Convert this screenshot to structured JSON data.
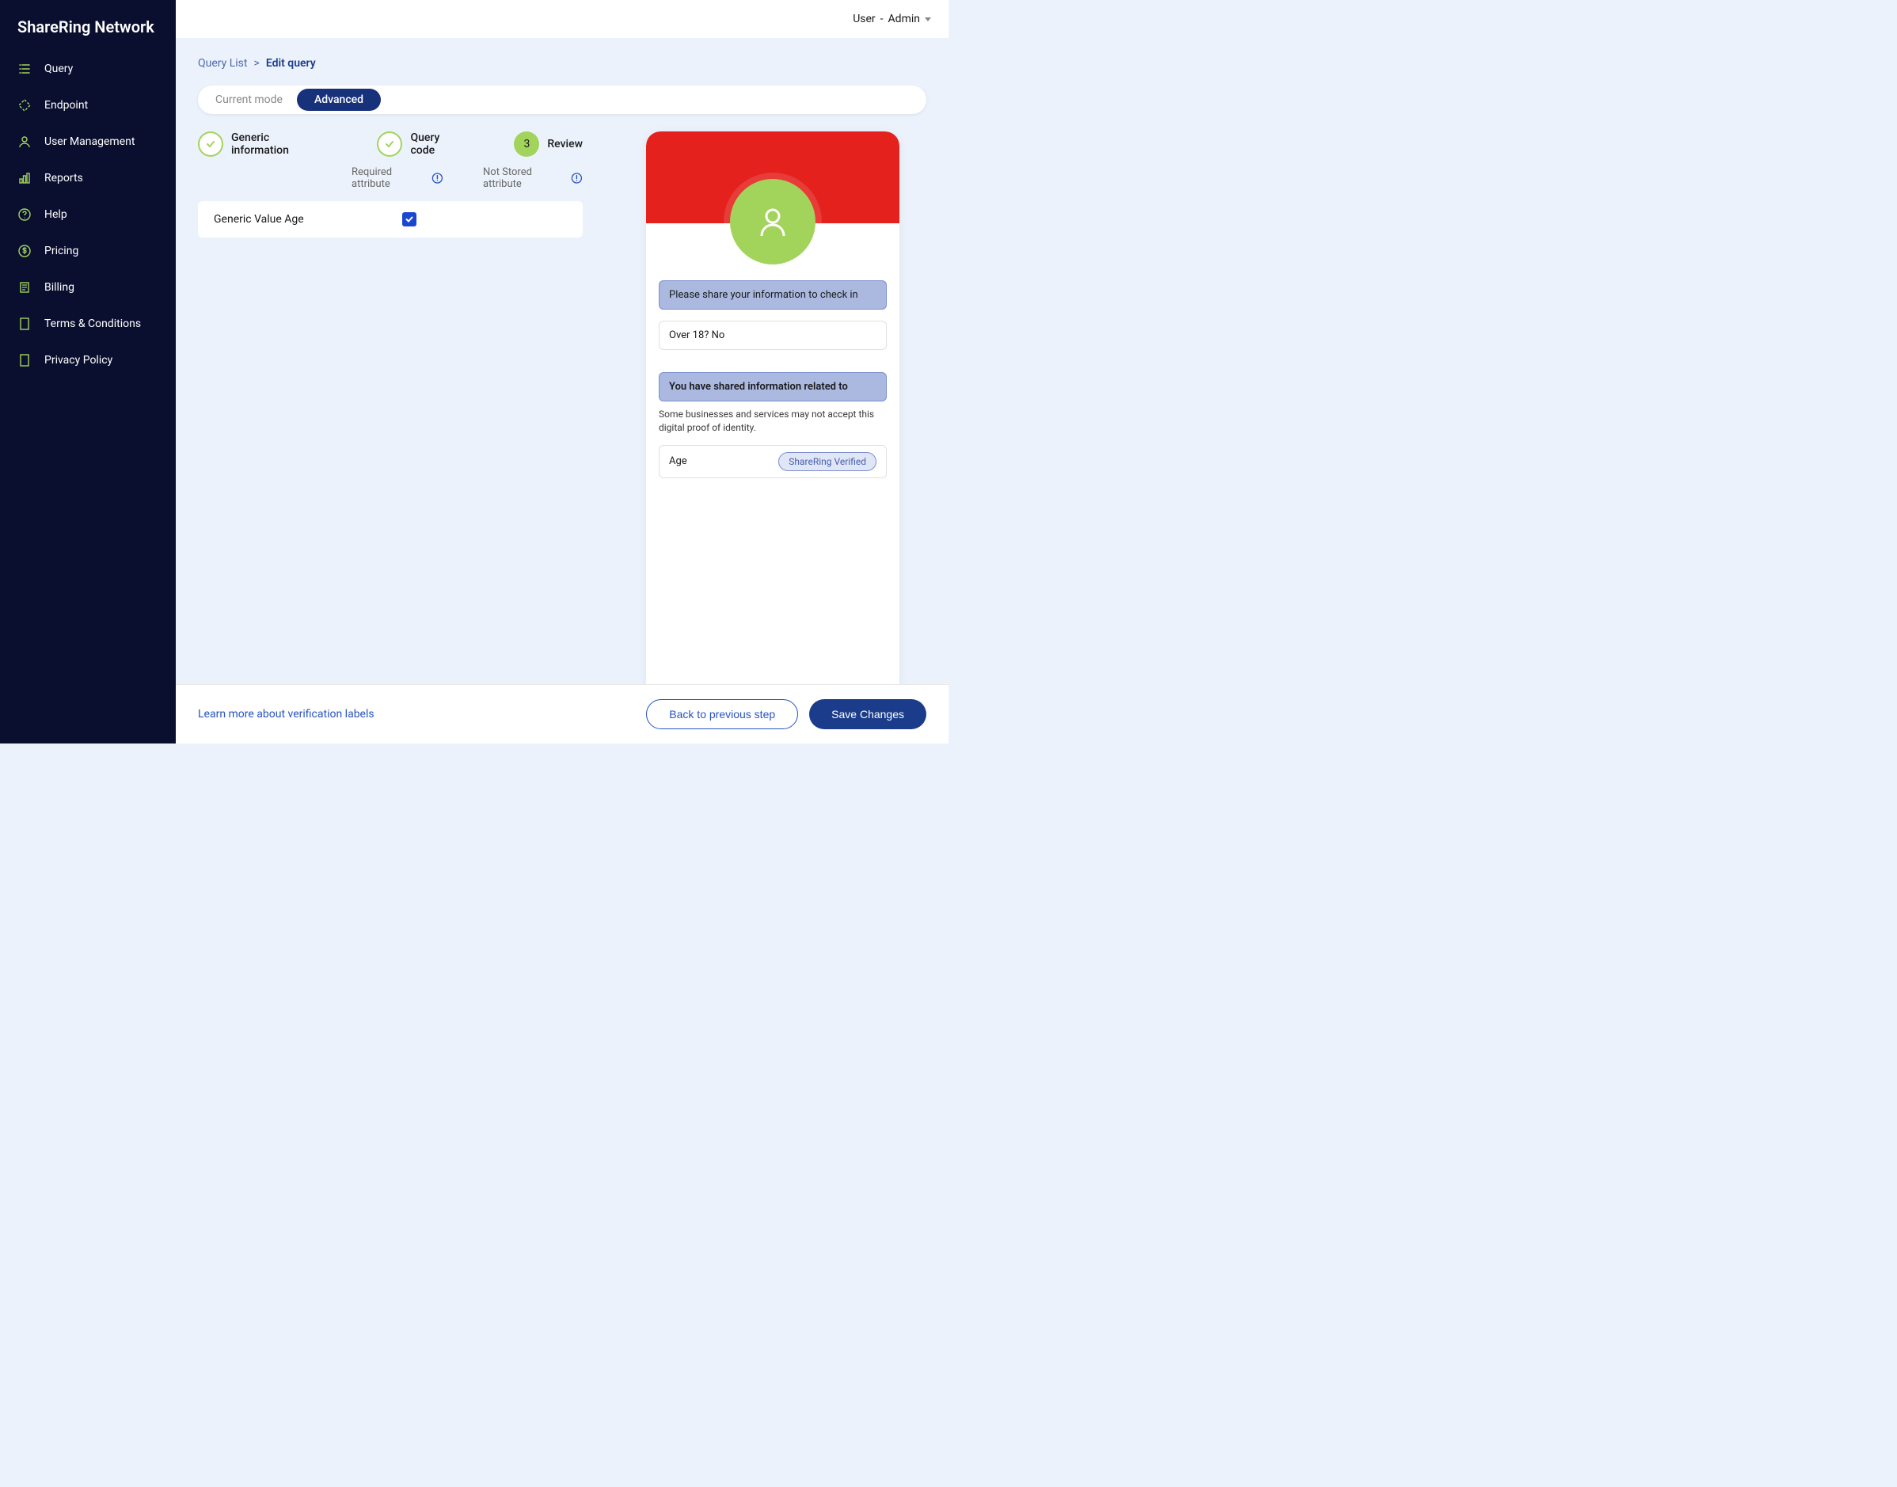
{
  "sidebar": {
    "logo": "ShareRing Network",
    "items": [
      {
        "label": "Query"
      },
      {
        "label": "Endpoint"
      },
      {
        "label": "User Management"
      },
      {
        "label": "Reports"
      },
      {
        "label": "Help"
      },
      {
        "label": "Pricing"
      },
      {
        "label": "Billing"
      },
      {
        "label": "Terms & Conditions"
      },
      {
        "label": "Privacy Policy"
      }
    ]
  },
  "header": {
    "user_label": "User",
    "role_label": "Admin"
  },
  "breadcrumb": {
    "parent": "Query List",
    "current": "Edit query"
  },
  "mode": {
    "label": "Current mode",
    "active": "Advanced"
  },
  "steps": [
    {
      "label": "Generic information"
    },
    {
      "label": "Query code"
    },
    {
      "number": "3",
      "label": "Review"
    }
  ],
  "legend": {
    "required": "Required attribute",
    "not_stored": "Not Stored attribute"
  },
  "attribute": {
    "label": "Generic Value Age"
  },
  "preview": {
    "share_prompt": "Please share your information to check in",
    "question": "Over 18? No",
    "shared_title": "You have shared information related to",
    "disclaimer": "Some businesses and services may not accept this digital proof of identity.",
    "field_label": "Age",
    "verified_label": "ShareRing Verified"
  },
  "footer": {
    "link": "Learn more about verification labels",
    "back_label": "Back to previous step",
    "save_label": "Save Changes"
  }
}
